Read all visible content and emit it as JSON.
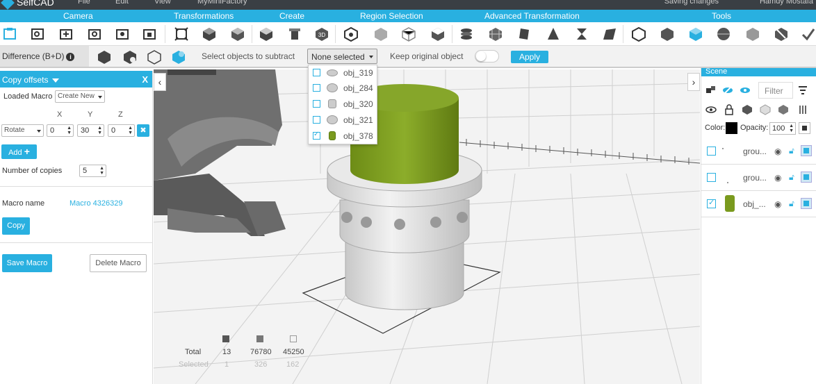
{
  "app": {
    "logo_text": "SelfCAD",
    "menu": [
      "File",
      "Edit",
      "View",
      "MyMiniFactory"
    ],
    "status": "Saving changes",
    "user": "Hamdy Mostafa"
  },
  "categories": [
    "Camera",
    "Transformations",
    "Create",
    "Region Selection",
    "Advanced Transformation",
    "Tools"
  ],
  "operation": {
    "title": "Difference (B+D)",
    "info_icon": "i",
    "select_label": "Select objects to subtract",
    "select_value": "None selected",
    "keep_label": "Keep original object",
    "apply_label": "Apply"
  },
  "dropdown": {
    "items": [
      {
        "name": "obj_319",
        "checked": false
      },
      {
        "name": "obj_284",
        "checked": false
      },
      {
        "name": "obj_320",
        "checked": false
      },
      {
        "name": "obj_321",
        "checked": false
      },
      {
        "name": "obj_378",
        "checked": true
      }
    ]
  },
  "left_panel": {
    "title": "Copy offsets",
    "close": "X",
    "loaded_macro_label": "Loaded Macro",
    "loaded_macro_value": "Create New",
    "axis_x": "X",
    "axis_y": "Y",
    "axis_z": "Z",
    "op_value": "Rotate",
    "x_value": "0",
    "y_value": "30",
    "z_value": "0",
    "clear_icon": "✖",
    "add_label": "Add",
    "add_plus": "+",
    "copies_label": "Number of copies",
    "copies_value": "5",
    "macro_name_label": "Macro name",
    "macro_name_value": "Macro 4326329",
    "copy_label": "Copy",
    "save_macro_label": "Save Macro",
    "delete_macro_label": "Delete Macro"
  },
  "viewport": {
    "nav_left": "‹",
    "nav_right": "›",
    "stats": {
      "total_label": "Total",
      "selected_label": "Selected",
      "total_values": [
        "13",
        "76780",
        "45250"
      ],
      "selected_values": [
        "1",
        "326",
        "162"
      ]
    }
  },
  "right_panel": {
    "title": "Scene",
    "filter_placeholder": "Filter",
    "color_label": "Color:",
    "color_value": "#000000",
    "opacity_label": "Opacity:",
    "opacity_value": "100",
    "rows": [
      {
        "name": "grou...",
        "checked": false
      },
      {
        "name": "grou...",
        "checked": false
      },
      {
        "name": "obj_...",
        "checked": true
      }
    ]
  },
  "colors": {
    "accent": "#29b0e0",
    "green_object": "#7a9a1e"
  }
}
